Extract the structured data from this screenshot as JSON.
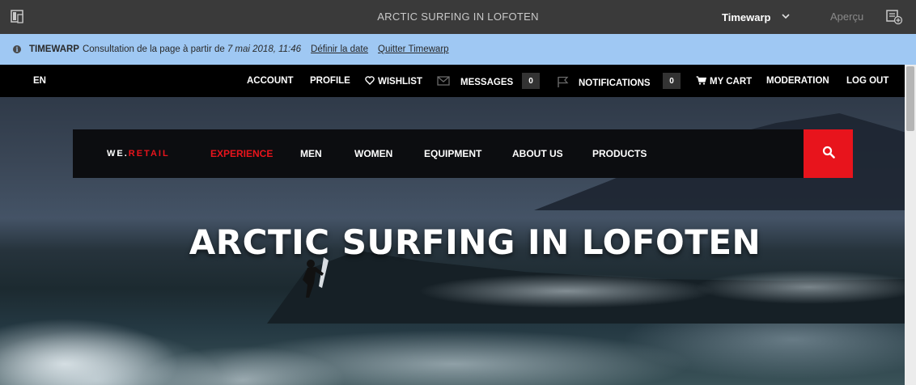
{
  "editor": {
    "page_title": "ARCTIC SURFING IN LOFOTEN",
    "mode_label": "Timewarp",
    "preview_label": "Aperçu"
  },
  "timewarp": {
    "label": "TIMEWARP",
    "message": "Consultation de la page à partir de",
    "date": "7 mai 2018, 11:46",
    "set_date_link": "Définir la date",
    "quit_link": "Quitter Timewarp"
  },
  "utility_nav": {
    "language": "EN",
    "account": "ACCOUNT",
    "profile": "PROFILE",
    "wishlist": "WISHLIST",
    "messages": "MESSAGES",
    "messages_count": "0",
    "notifications": "NOTIFICATIONS",
    "notifications_count": "0",
    "cart": "MY CART",
    "moderation": "MODERATION",
    "logout": "LOG OUT"
  },
  "main_nav": {
    "logo_prefix": "WE.",
    "logo_accent": "RETAIL",
    "items": [
      "EXPERIENCE",
      "MEN",
      "WOMEN",
      "EQUIPMENT",
      "ABOUT US",
      "PRODUCTS"
    ],
    "active_item": "EXPERIENCE"
  },
  "hero": {
    "title": "ARCTIC SURFING IN LOFOTEN"
  },
  "colors": {
    "accent": "#e8141c",
    "timewarp_bar": "#9fc8f3",
    "editor_bar": "#3a3a3a"
  },
  "icons": {
    "panel_toggle": "side-panel-icon",
    "mode_chevron": "chevron-down-icon",
    "annotate": "annotate-icon",
    "info": "info-icon",
    "wishlist": "heart-icon",
    "messages": "envelope-icon",
    "notifications": "flag-icon",
    "cart": "cart-icon",
    "search": "search-icon"
  }
}
